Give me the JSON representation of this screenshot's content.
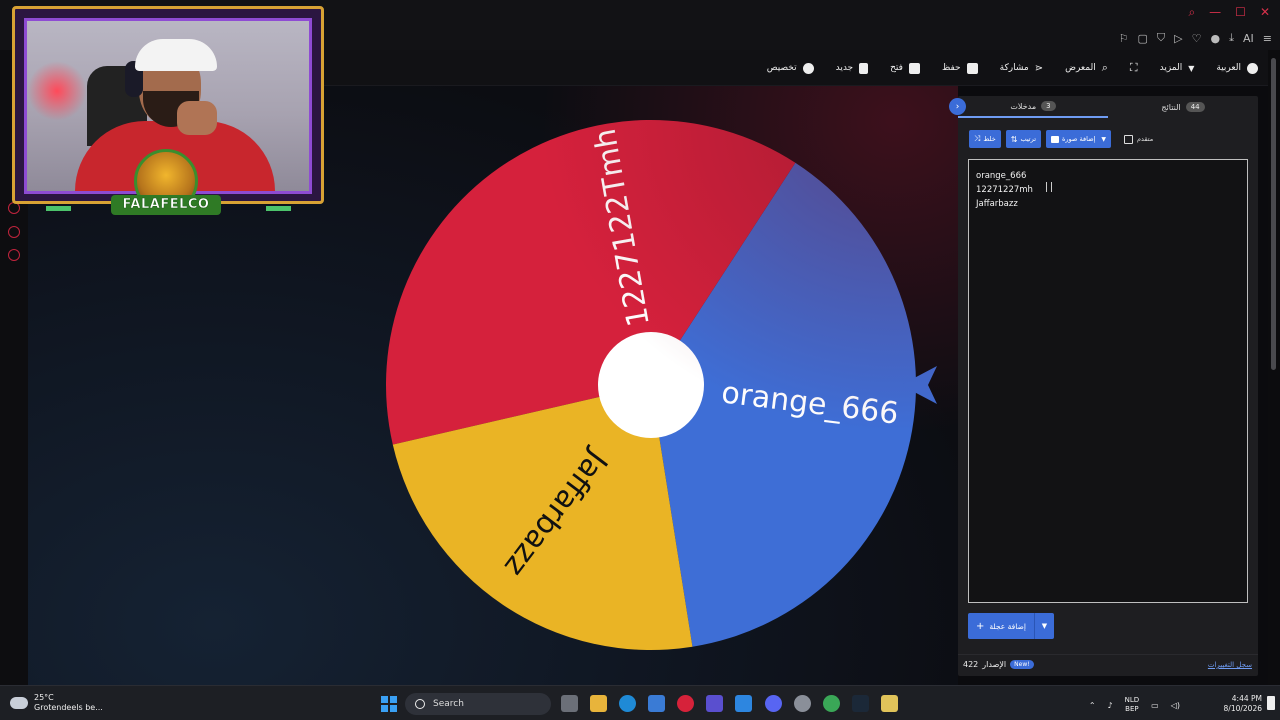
{
  "browser": {
    "window_controls": [
      "search",
      "minimize",
      "maximize",
      "close"
    ],
    "toolbar_icons": [
      "bookmark-icon",
      "snapshot-icon",
      "shield-icon",
      "play-icon",
      "heart-icon",
      "account-icon",
      "download-icon",
      "ai-icon",
      "menu-icon"
    ],
    "ai_label": "AI"
  },
  "nav": {
    "items": [
      {
        "label": "العربية",
        "icon": "globe-icon"
      },
      {
        "label": "المزيد",
        "icon": "chevron-down-icon"
      },
      {
        "label": "",
        "icon": "fullscreen-icon"
      },
      {
        "label": "المعرض",
        "icon": "search-icon"
      },
      {
        "label": "مشاركة",
        "icon": "share-icon"
      },
      {
        "label": "حفظ",
        "icon": "save-icon"
      },
      {
        "label": "فتح",
        "icon": "folder-icon"
      },
      {
        "label": "جديد",
        "icon": "file-icon"
      },
      {
        "label": "تخصيص",
        "icon": "palette-icon"
      }
    ]
  },
  "wheel": {
    "entries": [
      {
        "label": "orange_666",
        "color": "#3e6ed6"
      },
      {
        "label": "1227122Tmh",
        "color": "#d5213c"
      },
      {
        "label": "Jaffarbazz",
        "color": "#eab425"
      }
    ],
    "pointer_color": "#3e6ed6",
    "center_color": "#ffffff"
  },
  "panel": {
    "tabs": [
      {
        "label": "مدخلات",
        "count": "3",
        "active": true
      },
      {
        "label": "النتائج",
        "count": "44",
        "active": false
      }
    ],
    "toolbar": {
      "shuffle": "خلط",
      "sort": "ترتيب",
      "add_image": "إضافة صورة",
      "advanced": "متقدم"
    },
    "entries_text": [
      "orange_666",
      "12271227mh",
      "Jaffarbazz"
    ],
    "add_wheel": "إضافة عجلة",
    "version_label": "الإصدار",
    "version": "422",
    "new_badge": "New!",
    "changelog": "سجل التغييرات"
  },
  "webcam": {
    "logo_text": "FALAFELCO"
  },
  "taskbar": {
    "weather_temp": "25°C",
    "weather_desc": "Grotendeels be...",
    "search_placeholder": "Search",
    "lang_1": "NLD",
    "lang_2": "BEP",
    "time": "4:44 PM",
    "date": "8/10/2026"
  }
}
